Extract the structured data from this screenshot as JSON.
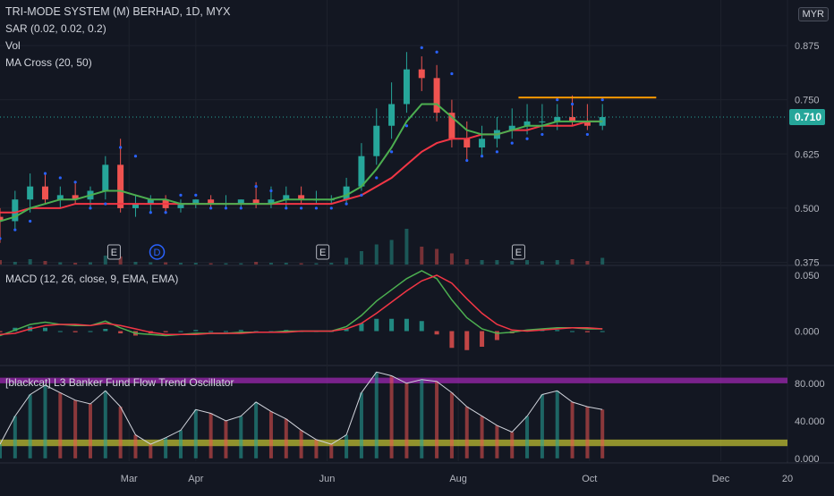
{
  "legend": {
    "title": "TRI-MODE SYSTEM (M) BERHAD, 1D, MYX",
    "sar": "SAR (0.02, 0.02, 0.2)",
    "vol": "Vol",
    "ma_cross": "MA Cross (20, 50)"
  },
  "currency": "MYR",
  "macd_label": "MACD (12, 26, close, 9, EMA, EMA)",
  "osc_label": "[blackcat] L3 Banker Fund Flow Trend Oscillator",
  "last_price_label": "0.710",
  "colors": {
    "background": "#131722",
    "up": "#26a69a",
    "down": "#ef5350",
    "ma_fast": "#4caf50",
    "ma_slow": "#f23645",
    "sar": "#2962ff",
    "resistance": "#ff9800",
    "last_price": "#26a69a",
    "osc_upper_band": "#9c27b0",
    "osc_lower_band": "#c8c832"
  },
  "events": [
    {
      "label": "E",
      "x": "2024-02-23"
    },
    {
      "label": "D",
      "x": "2024-03-14"
    },
    {
      "label": "E",
      "x": "2024-05-30"
    },
    {
      "label": "E",
      "x": "2024-08-29"
    }
  ],
  "chart_data": [
    {
      "type": "candlestick",
      "title": "TRI-MODE SYSTEM (M) BERHAD, 1D, MYX",
      "x_ticks": [
        "Mar",
        "Apr",
        "Jun",
        "Aug",
        "Oct",
        "Dec",
        "20"
      ],
      "y_ticks": [
        0.375,
        0.5,
        0.625,
        0.75,
        0.875
      ],
      "ylim": [
        0.37,
        0.98
      ],
      "last_price": 0.71,
      "resistance": {
        "y": 0.755,
        "x": [
          "2024-08-29",
          "2024-11-01"
        ]
      },
      "grid": true,
      "x": [
        "2024-01-01",
        "2024-01-08",
        "2024-01-15",
        "2024-01-22",
        "2024-01-29",
        "2024-02-05",
        "2024-02-12",
        "2024-02-19",
        "2024-02-26",
        "2024-03-04",
        "2024-03-11",
        "2024-03-18",
        "2024-03-25",
        "2024-04-01",
        "2024-04-08",
        "2024-04-15",
        "2024-04-22",
        "2024-04-29",
        "2024-05-06",
        "2024-05-13",
        "2024-05-20",
        "2024-05-27",
        "2024-06-03",
        "2024-06-10",
        "2024-06-17",
        "2024-06-24",
        "2024-07-01",
        "2024-07-08",
        "2024-07-15",
        "2024-07-22",
        "2024-07-29",
        "2024-08-05",
        "2024-08-12",
        "2024-08-19",
        "2024-08-26",
        "2024-09-02",
        "2024-09-09",
        "2024-09-16",
        "2024-09-23",
        "2024-09-30",
        "2024-10-07"
      ],
      "open": [
        0.48,
        0.47,
        0.52,
        0.55,
        0.52,
        0.53,
        0.52,
        0.54,
        0.6,
        0.5,
        0.51,
        0.52,
        0.5,
        0.51,
        0.52,
        0.51,
        0.51,
        0.52,
        0.51,
        0.52,
        0.53,
        0.52,
        0.52,
        0.52,
        0.55,
        0.62,
        0.69,
        0.74,
        0.82,
        0.8,
        0.72,
        0.66,
        0.64,
        0.66,
        0.68,
        0.69,
        0.7,
        0.7,
        0.71,
        0.7,
        0.69
      ],
      "high": [
        0.5,
        0.54,
        0.58,
        0.58,
        0.55,
        0.56,
        0.55,
        0.62,
        0.66,
        0.53,
        0.53,
        0.53,
        0.52,
        0.52,
        0.53,
        0.53,
        0.52,
        0.56,
        0.55,
        0.55,
        0.55,
        0.54,
        0.53,
        0.57,
        0.65,
        0.73,
        0.79,
        0.86,
        0.85,
        0.83,
        0.75,
        0.7,
        0.69,
        0.71,
        0.73,
        0.74,
        0.74,
        0.74,
        0.76,
        0.74,
        0.74
      ],
      "low": [
        0.42,
        0.45,
        0.49,
        0.51,
        0.5,
        0.51,
        0.5,
        0.52,
        0.49,
        0.48,
        0.49,
        0.49,
        0.49,
        0.5,
        0.5,
        0.5,
        0.5,
        0.5,
        0.5,
        0.5,
        0.51,
        0.51,
        0.51,
        0.51,
        0.54,
        0.6,
        0.66,
        0.72,
        0.77,
        0.7,
        0.64,
        0.61,
        0.62,
        0.64,
        0.66,
        0.67,
        0.68,
        0.68,
        0.69,
        0.68,
        0.68
      ],
      "close": [
        0.47,
        0.52,
        0.55,
        0.52,
        0.53,
        0.52,
        0.54,
        0.6,
        0.5,
        0.51,
        0.52,
        0.5,
        0.51,
        0.52,
        0.51,
        0.51,
        0.52,
        0.51,
        0.52,
        0.53,
        0.52,
        0.52,
        0.52,
        0.55,
        0.62,
        0.69,
        0.74,
        0.82,
        0.8,
        0.72,
        0.66,
        0.64,
        0.66,
        0.68,
        0.69,
        0.7,
        0.7,
        0.71,
        0.7,
        0.69,
        0.71
      ],
      "ma_fast": [
        0.47,
        0.48,
        0.5,
        0.51,
        0.52,
        0.52,
        0.53,
        0.54,
        0.54,
        0.53,
        0.52,
        0.52,
        0.51,
        0.51,
        0.51,
        0.51,
        0.51,
        0.51,
        0.51,
        0.52,
        0.52,
        0.52,
        0.52,
        0.53,
        0.55,
        0.59,
        0.64,
        0.7,
        0.74,
        0.74,
        0.71,
        0.68,
        0.67,
        0.67,
        0.68,
        0.69,
        0.69,
        0.7,
        0.7,
        0.7,
        0.7
      ],
      "ma_slow": [
        0.49,
        0.49,
        0.5,
        0.5,
        0.5,
        0.51,
        0.51,
        0.51,
        0.51,
        0.51,
        0.51,
        0.51,
        0.51,
        0.51,
        0.51,
        0.51,
        0.51,
        0.51,
        0.51,
        0.51,
        0.51,
        0.51,
        0.51,
        0.52,
        0.53,
        0.55,
        0.57,
        0.6,
        0.63,
        0.65,
        0.66,
        0.66,
        0.67,
        0.67,
        0.68,
        0.68,
        0.69,
        0.69,
        0.69,
        0.7,
        0.7
      ],
      "sar": [
        0.43,
        0.45,
        0.47,
        0.58,
        0.57,
        0.56,
        0.5,
        0.51,
        0.64,
        0.62,
        0.49,
        0.49,
        0.53,
        0.53,
        0.5,
        0.5,
        0.5,
        0.55,
        0.54,
        0.5,
        0.5,
        0.5,
        0.5,
        0.51,
        0.53,
        0.57,
        0.63,
        0.69,
        0.87,
        0.86,
        0.81,
        0.61,
        0.62,
        0.63,
        0.65,
        0.66,
        0.67,
        0.75,
        0.74,
        0.67,
        0.75
      ],
      "volume": [
        0.1,
        0.06,
        0.12,
        0.08,
        0.05,
        0.04,
        0.05,
        0.2,
        0.18,
        0.06,
        0.05,
        0.05,
        0.04,
        0.04,
        0.03,
        0.03,
        0.03,
        0.06,
        0.04,
        0.04,
        0.03,
        0.03,
        0.04,
        0.15,
        0.3,
        0.45,
        0.55,
        0.8,
        0.4,
        0.35,
        0.25,
        0.12,
        0.1,
        0.1,
        0.08,
        0.1,
        0.08,
        0.1,
        0.12,
        0.08,
        0.15
      ]
    },
    {
      "type": "bar",
      "title": "MACD (12, 26, close, 9, EMA, EMA)",
      "y_ticks": [
        0.0,
        0.05
      ],
      "ylim": [
        -0.03,
        0.058
      ],
      "x": [
        "2024-01-01",
        "2024-01-08",
        "2024-01-15",
        "2024-01-22",
        "2024-01-29",
        "2024-02-05",
        "2024-02-12",
        "2024-02-19",
        "2024-02-26",
        "2024-03-04",
        "2024-03-11",
        "2024-03-18",
        "2024-03-25",
        "2024-04-01",
        "2024-04-08",
        "2024-04-15",
        "2024-04-22",
        "2024-04-29",
        "2024-05-06",
        "2024-05-13",
        "2024-05-20",
        "2024-05-27",
        "2024-06-03",
        "2024-06-10",
        "2024-06-17",
        "2024-06-24",
        "2024-07-01",
        "2024-07-08",
        "2024-07-15",
        "2024-07-22",
        "2024-07-29",
        "2024-08-05",
        "2024-08-12",
        "2024-08-19",
        "2024-08-26",
        "2024-09-02",
        "2024-09-09",
        "2024-09-16",
        "2024-09-23",
        "2024-09-30",
        "2024-10-07"
      ],
      "series": [
        {
          "name": "MACD",
          "values": [
            -0.004,
            0.001,
            0.006,
            0.008,
            0.006,
            0.005,
            0.005,
            0.009,
            0.003,
            -0.002,
            -0.003,
            -0.004,
            -0.003,
            -0.002,
            -0.002,
            -0.002,
            -0.001,
            -0.001,
            -0.001,
            0.0,
            0.0,
            0.0,
            0.0,
            0.004,
            0.014,
            0.027,
            0.037,
            0.047,
            0.054,
            0.047,
            0.028,
            0.012,
            0.002,
            -0.002,
            -0.001,
            0.001,
            0.002,
            0.003,
            0.003,
            0.002,
            0.002
          ]
        },
        {
          "name": "Signal",
          "values": [
            -0.003,
            -0.002,
            0.002,
            0.005,
            0.006,
            0.006,
            0.005,
            0.007,
            0.005,
            0.002,
            -0.001,
            -0.003,
            -0.003,
            -0.003,
            -0.002,
            -0.002,
            -0.002,
            -0.001,
            -0.001,
            -0.001,
            0.0,
            0.0,
            0.0,
            0.002,
            0.007,
            0.016,
            0.026,
            0.036,
            0.045,
            0.05,
            0.043,
            0.029,
            0.016,
            0.006,
            0.001,
            0.0,
            0.001,
            0.002,
            0.003,
            0.003,
            0.002
          ]
        },
        {
          "name": "Histogram",
          "values": [
            -0.001,
            0.003,
            0.004,
            0.003,
            0.0,
            -0.001,
            0.0,
            0.002,
            -0.002,
            -0.004,
            -0.002,
            -0.001,
            0.0,
            0.001,
            0.0,
            0.0,
            0.001,
            0.0,
            0.0,
            0.001,
            0.0,
            0.0,
            0.0,
            0.002,
            0.007,
            0.011,
            0.011,
            0.011,
            0.009,
            -0.003,
            -0.015,
            -0.017,
            -0.014,
            -0.008,
            -0.002,
            0.001,
            0.001,
            0.001,
            0.0,
            -0.001,
            0.0
          ]
        }
      ]
    },
    {
      "type": "bar",
      "title": "[blackcat] L3 Banker Fund Flow Trend Oscillator",
      "y_ticks": [
        0.0,
        40.0,
        80.0
      ],
      "ylim": [
        -3,
        98
      ],
      "bands": {
        "upper": [
          80,
          86
        ],
        "lower": [
          13,
          20
        ]
      },
      "x": [
        "2024-01-01",
        "2024-01-08",
        "2024-01-15",
        "2024-01-22",
        "2024-01-29",
        "2024-02-05",
        "2024-02-12",
        "2024-02-19",
        "2024-02-26",
        "2024-03-04",
        "2024-03-11",
        "2024-03-18",
        "2024-03-25",
        "2024-04-01",
        "2024-04-08",
        "2024-04-15",
        "2024-04-22",
        "2024-04-29",
        "2024-05-06",
        "2024-05-13",
        "2024-05-20",
        "2024-05-27",
        "2024-06-03",
        "2024-06-10",
        "2024-06-17",
        "2024-06-24",
        "2024-07-01",
        "2024-07-08",
        "2024-07-15",
        "2024-07-22",
        "2024-07-29",
        "2024-08-05",
        "2024-08-12",
        "2024-08-19",
        "2024-08-26",
        "2024-09-02",
        "2024-09-09",
        "2024-09-16",
        "2024-09-23",
        "2024-09-30",
        "2024-10-07"
      ],
      "series": [
        {
          "name": "Trend",
          "values": [
            15,
            45,
            68,
            78,
            70,
            62,
            58,
            72,
            55,
            25,
            15,
            22,
            30,
            52,
            48,
            40,
            45,
            60,
            50,
            42,
            30,
            20,
            15,
            25,
            70,
            92,
            88,
            80,
            84,
            82,
            70,
            55,
            45,
            35,
            28,
            45,
            68,
            72,
            60,
            55,
            52
          ]
        }
      ]
    }
  ]
}
